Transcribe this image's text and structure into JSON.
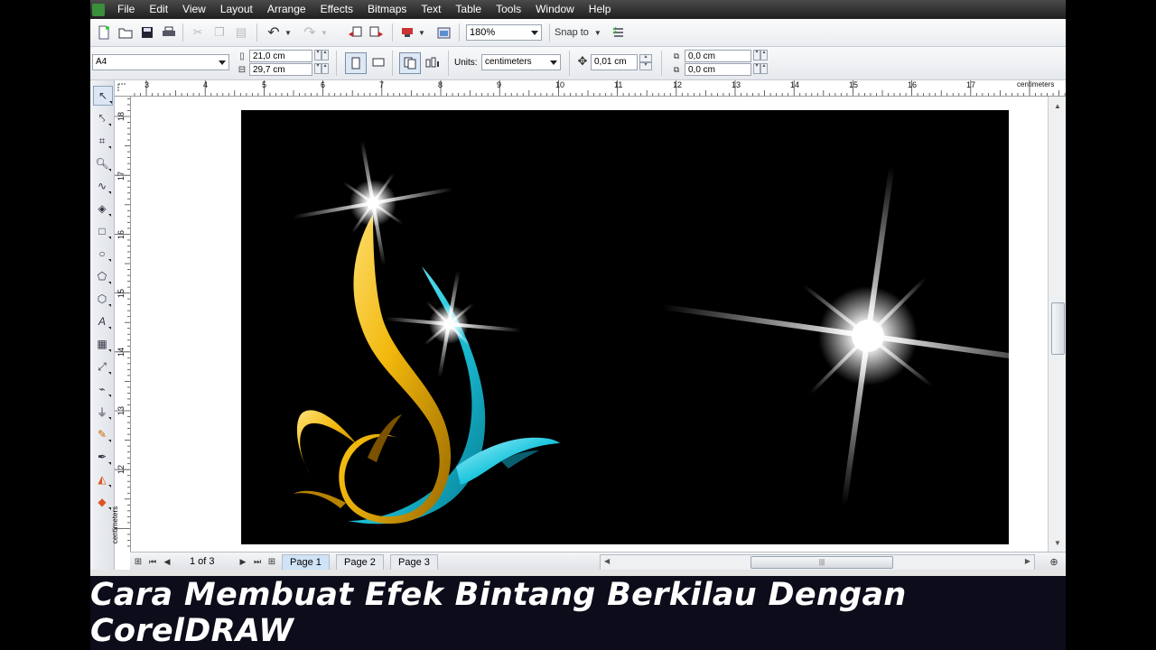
{
  "menu": [
    "File",
    "Edit",
    "View",
    "Layout",
    "Arrange",
    "Effects",
    "Bitmaps",
    "Text",
    "Table",
    "Tools",
    "Window",
    "Help"
  ],
  "toolbar": {
    "zoom": "180%",
    "snap_to": "Snap to"
  },
  "property_bar": {
    "paper_size": "A4",
    "width": "21,0 cm",
    "height": "29,7 cm",
    "units_label": "Units:",
    "units_value": "centimeters",
    "nudge": "0,01 cm",
    "dup_x": "0,0 cm",
    "dup_y": "0,0 cm"
  },
  "ruler": {
    "h_ticks": [
      "3",
      "4",
      "5",
      "6",
      "7",
      "8",
      "9",
      "10",
      "11",
      "12",
      "13",
      "14",
      "15",
      "16",
      "17"
    ],
    "h_unit": "centimeters",
    "v_ticks": [
      "18",
      "17",
      "16",
      "15",
      "14",
      "13",
      "12"
    ],
    "v_unit": "centimeters"
  },
  "status": {
    "page_count": "1 of 3",
    "pages": [
      "Page 1",
      "Page 2",
      "Page 3"
    ]
  },
  "caption": "Cara Membuat Efek Bintang Berkilau Dengan CorelDRAW"
}
